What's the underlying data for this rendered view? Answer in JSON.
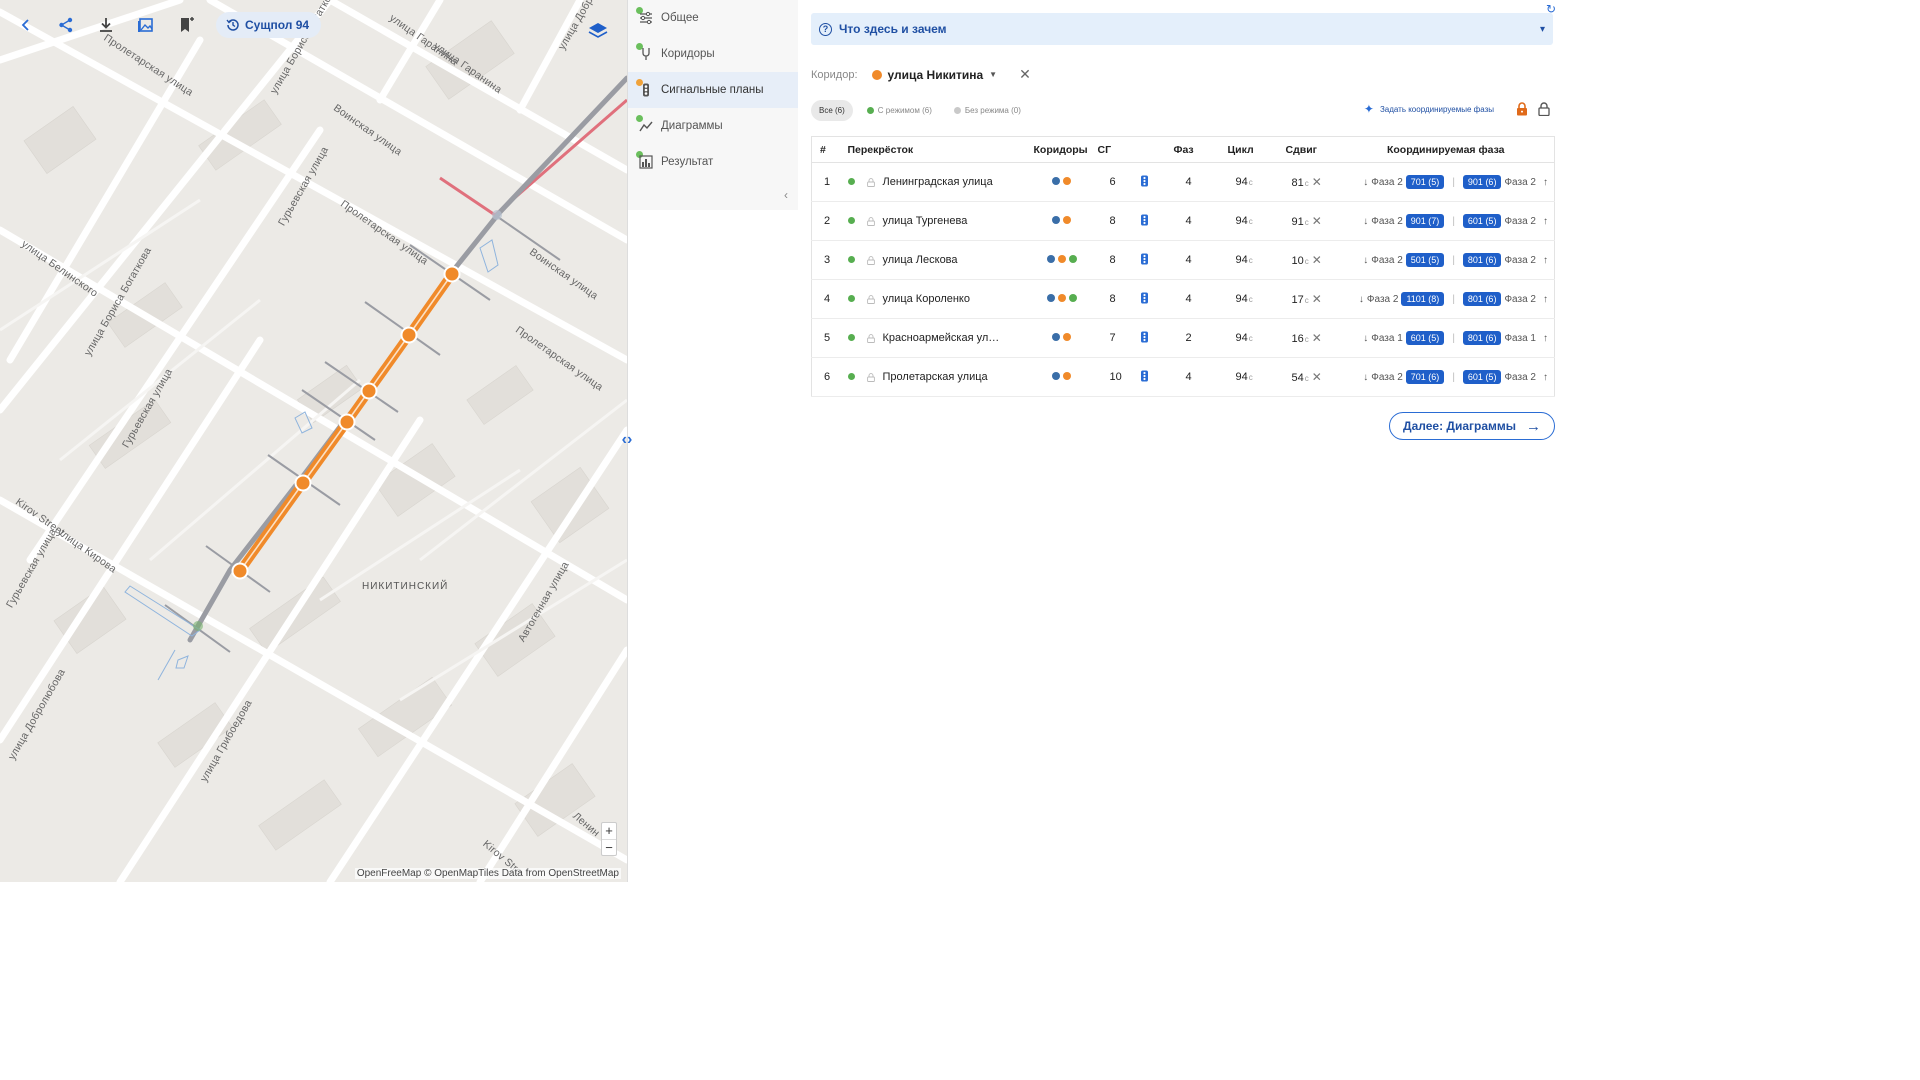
{
  "map": {
    "toolbar": {
      "version_label": "Сущпол 94"
    },
    "street_labels": {
      "l1": "Пролетарская улица",
      "l2": "улица Бориса Богаткова",
      "l3": "улица Гаранина",
      "l4": "улица Гаранина",
      "l5": "Воинская улица",
      "l6": "Гурьевская улица",
      "l7": "Пролетарская улица",
      "l8": "Воинская улица",
      "l9": "улица Белинского",
      "l10": "улица Бориса Богаткова",
      "l11": "Пролетарская улица",
      "l12": "Гурьевская улица",
      "l13": "Kirov Street",
      "l14": "улица Кирова",
      "l15": "Гурьевская улица",
      "l16": "Автогенная улица",
      "l17": "улица Добролюбова",
      "l18": "улица Грибоедова",
      "l19": "Kirov Stre",
      "l20": "Ленин",
      "l21": "улица Добролю"
    },
    "district_label": "НИКИТИНСКИЙ",
    "zoom_in": "+",
    "zoom_out": "−",
    "attribution": {
      "a1": "OpenFreeMap",
      "a2": " © ",
      "a3": "OpenMapTiles",
      "a4": " Data from ",
      "a5": "OpenStreetMap"
    }
  },
  "steps": [
    {
      "label": "Общее",
      "icon": "sliders-icon",
      "status": "done"
    },
    {
      "label": "Коридоры",
      "icon": "fork-icon",
      "status": "done"
    },
    {
      "label": "Сигнальные планы",
      "icon": "traffic-light-icon",
      "status": "in-progress"
    },
    {
      "label": "Диаграммы",
      "icon": "chart-line-icon",
      "status": "done"
    },
    {
      "label": "Результат",
      "icon": "bar-chart-icon",
      "status": "done"
    }
  ],
  "help": {
    "title": "Что здесь и зачем"
  },
  "corridor": {
    "label": "Коридор:",
    "value": "улица Никитина",
    "color": "#f08a2a"
  },
  "filters": {
    "all": "Все (6)",
    "with_mode": "С режимом (6)",
    "without_mode": "Без режима (0)"
  },
  "actions": {
    "set_phases": "Задать координируемые фазы"
  },
  "table": {
    "headers": {
      "num": "#",
      "intersection": "Перекрёсток",
      "corridors": "Коридоры",
      "sg": "СГ",
      "phases": "Фаз",
      "cycle": "Цикл",
      "shift": "Сдвиг",
      "coord_phase": "Координируемая фаза"
    },
    "rows": [
      {
        "num": "1",
        "name": "Ленинградская улица",
        "dots": [
          "#3a6ea8",
          "#f08a2a"
        ],
        "sg": "6",
        "phases": "4",
        "cycle": "94",
        "shift": "81",
        "unit": "с",
        "left_phase": "Фаза 2",
        "left_badge": "701 (5)",
        "right_badge": "901 (6)",
        "right_phase": "Фаза 2"
      },
      {
        "num": "2",
        "name": "улица Тургенева",
        "dots": [
          "#3a6ea8",
          "#f08a2a"
        ],
        "sg": "8",
        "phases": "4",
        "cycle": "94",
        "shift": "91",
        "unit": "с",
        "left_phase": "Фаза 2",
        "left_badge": "901 (7)",
        "right_badge": "601 (5)",
        "right_phase": "Фаза 2"
      },
      {
        "num": "3",
        "name": "улица Лескова",
        "dots": [
          "#3a6ea8",
          "#f08a2a",
          "#57ae50"
        ],
        "sg": "8",
        "phases": "4",
        "cycle": "94",
        "shift": "10",
        "unit": "с",
        "left_phase": "Фаза 2",
        "left_badge": "501 (5)",
        "right_badge": "801 (6)",
        "right_phase": "Фаза 2"
      },
      {
        "num": "4",
        "name": "улица Короленко",
        "dots": [
          "#3a6ea8",
          "#f08a2a",
          "#57ae50"
        ],
        "sg": "8",
        "phases": "4",
        "cycle": "94",
        "shift": "17",
        "unit": "с",
        "left_phase": "Фаза 2",
        "left_badge": "1101 (8)",
        "right_badge": "801 (6)",
        "right_phase": "Фаза 2"
      },
      {
        "num": "5",
        "name": "Красноармейская ул…",
        "dots": [
          "#3a6ea8",
          "#f08a2a"
        ],
        "sg": "7",
        "phases": "2",
        "cycle": "94",
        "shift": "16",
        "unit": "с",
        "left_phase": "Фаза 1",
        "left_badge": "601 (5)",
        "right_badge": "801 (6)",
        "right_phase": "Фаза 1"
      },
      {
        "num": "6",
        "name": "Пролетарская улица",
        "dots": [
          "#3a6ea8",
          "#f08a2a"
        ],
        "sg": "10",
        "phases": "4",
        "cycle": "94",
        "shift": "54",
        "unit": "с",
        "left_phase": "Фаза 2",
        "left_badge": "701 (6)",
        "right_badge": "601 (5)",
        "right_phase": "Фаза 2"
      }
    ]
  },
  "next_button": {
    "label": "Далее: Диаграммы"
  },
  "colors": {
    "accent": "#1f5fc9",
    "corridor": "#f08a2a",
    "ok": "#57ae50",
    "lock": "#e06a1a"
  }
}
